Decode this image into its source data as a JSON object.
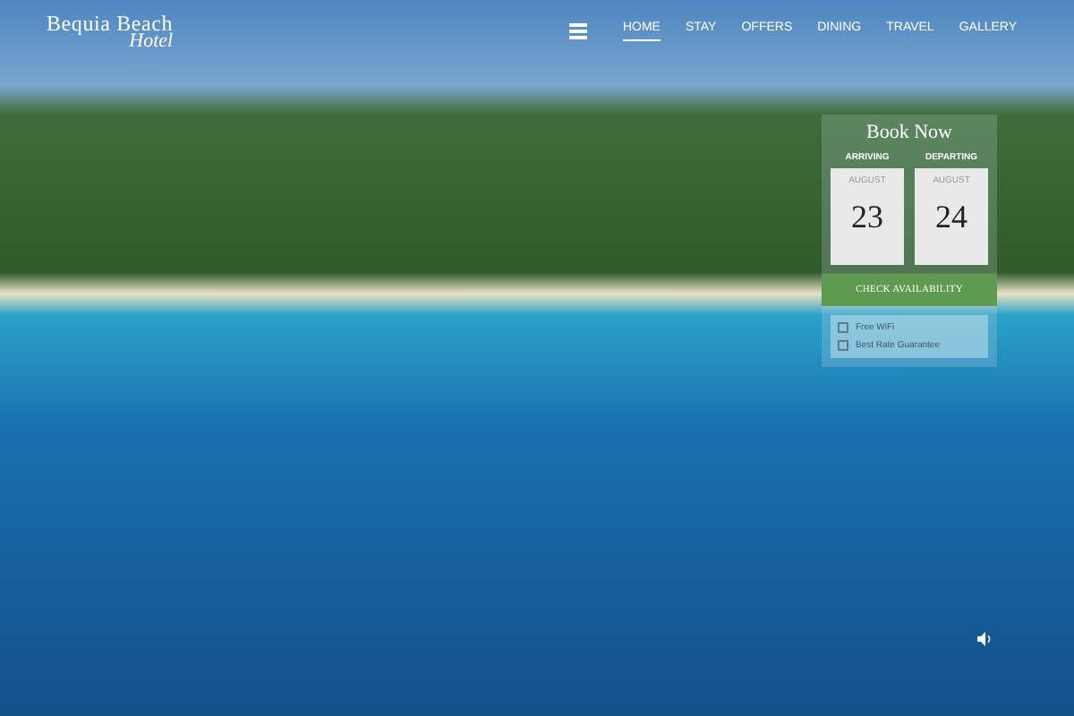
{
  "logo": {
    "title": "Bequia Beach",
    "subtitle": "Hotel"
  },
  "nav": {
    "items": [
      {
        "label": "HOME",
        "selected": true
      },
      {
        "label": "STAY",
        "selected": false
      },
      {
        "label": "OFFERS",
        "selected": false
      },
      {
        "label": "DINING",
        "selected": false
      },
      {
        "label": "TRAVEL",
        "selected": false
      },
      {
        "label": "GALLERY",
        "selected": false
      }
    ]
  },
  "booking": {
    "title": "Book Now",
    "dates": [
      {
        "label": "ARRIVING",
        "month": "AUGUST",
        "day": "23"
      },
      {
        "label": "DEPARTING",
        "month": "AUGUST",
        "day": "24"
      }
    ],
    "button": "CHECK AVAILABILITY",
    "options": [
      {
        "label": "Free WiFi",
        "checked": false
      },
      {
        "label": "Best Rate Guarantee",
        "checked": false
      }
    ]
  },
  "video": {
    "muted": false
  }
}
